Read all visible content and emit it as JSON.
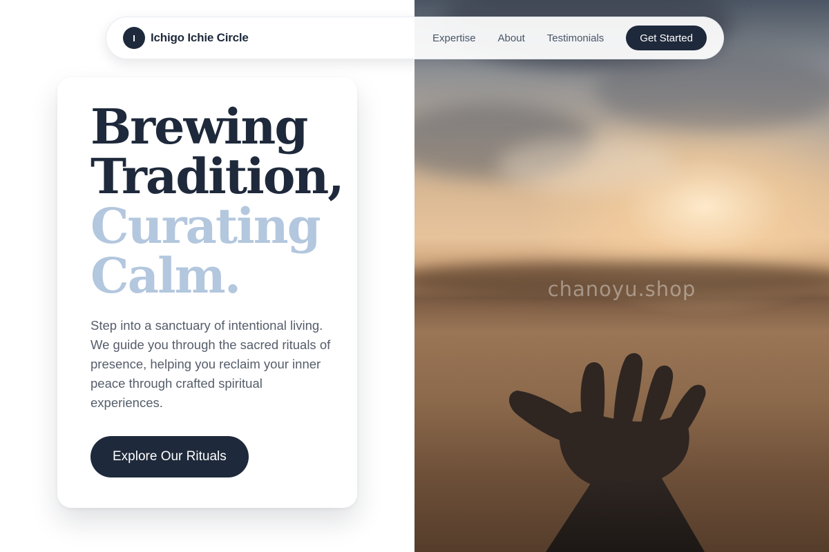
{
  "nav": {
    "logo_letter": "I",
    "brand": "Ichigo Ichie Circle",
    "links": [
      "Expertise",
      "About",
      "Testimonials"
    ],
    "cta": "Get Started"
  },
  "hero": {
    "headline_line1": "Brewing",
    "headline_line2": "Tradition,",
    "headline_accent_line1": "Curating",
    "headline_accent_line2": "Calm.",
    "body": "Step into a sanctuary of intentional living. We guide you through the sacred rituals of presence, helping you reclaim your inner peace through crafted spiritual experiences.",
    "cta": "Explore Our Rituals"
  },
  "photo": {
    "watermark": "chanoyu.shop",
    "subject": "outstretched-hand-at-sunset"
  },
  "colors": {
    "primary": "#1e293b",
    "accent": "#b3c7de",
    "body_text": "#555d6a",
    "nav_link": "#475569"
  }
}
